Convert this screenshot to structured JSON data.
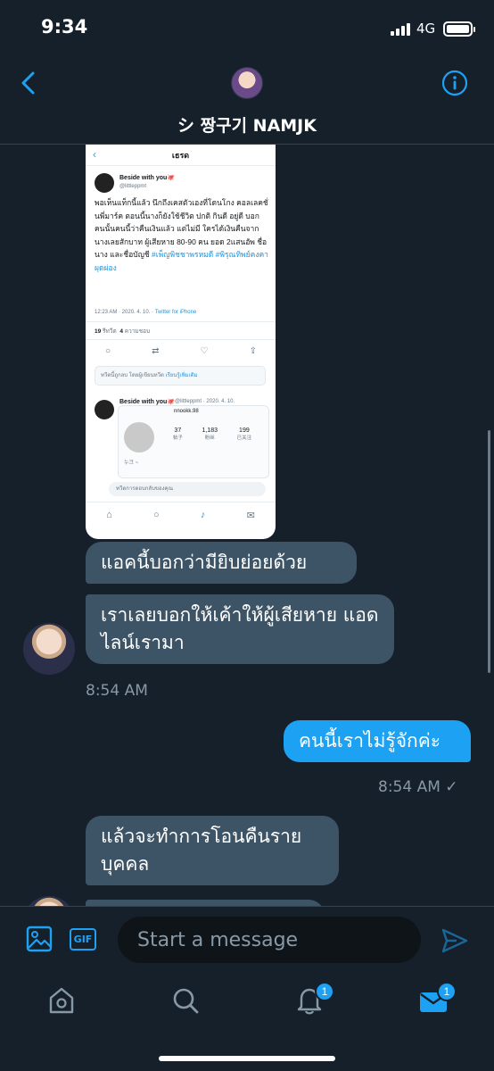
{
  "status_bar": {
    "time": "9:34",
    "network": "4G"
  },
  "header": {
    "contact_name": "シ 짱구기 NAMJK"
  },
  "attachment": {
    "title": "เธรด",
    "author_name": "Beside with you🐙",
    "author_handle": "@littleppmt",
    "body": "พอเห็นแท็กนี้แล้ว นึกถึงเคสตัวเองที่โดนโกง คอลเลคชั่นพี่มาร์ค ตอนนี้นางก็ยังใช้ชีวิต ปกติ กินดี อยู่ดี บอกคนนั้นคนนี้ว่าคืนเงินแล้ว แต่ไม่มี ใครได้เงินคืนจากนางเลยสักบาท ผู้เสียหาย 80-90 คน ยอด 2แสนอัพ ชื่อนาง และชื่อบัญชี",
    "hashtags": "#เพ็ญพิชชาพรหมดี #พิรุณทิพย์คงคาผุดผ่อง",
    "timestamp": "12:23 AM · 2020. 4. 10.",
    "source": "Twitter for iPhone",
    "retweets": "19",
    "retweets_label": "รีทวีต",
    "likes": "4",
    "likes_label": "ความชอบ",
    "notice": "ทวีตนี้ถูกลบ โดยผู้เขียนทวีต",
    "notice_link": "เรียนรู้เพิ่มเติม",
    "quoted_author": "Beside with you🐙",
    "quoted_meta": "@littleppmt · 2020. 4. 10.",
    "quoted_profile": "nnookk.98",
    "quoted_stats": [
      {
        "value": "37",
        "label": "帖子"
      },
      {
        "value": "1,183",
        "label": "粉丝"
      },
      {
        "value": "199",
        "label": "已关注"
      }
    ],
    "quoted_caption": "누크 ~",
    "reply_placeholder": "ทวีตการตอบกลับของคุณ"
  },
  "messages": [
    {
      "id": "m1",
      "direction": "in",
      "text": "แอคนี้บอกว่ามียิบย่อยด้วย"
    },
    {
      "id": "m2",
      "direction": "in",
      "text": "เราเลยบอกให้เค้าให้ผู้เสียหาย แอดไลน์เรามา",
      "time": "8:54 AM"
    },
    {
      "id": "m3",
      "direction": "out",
      "text": "คนนี้เราไม่รู้จักค่ะ",
      "time": "8:54 AM",
      "status": "✓"
    },
    {
      "id": "m4",
      "direction": "in",
      "text": "แล้วจะทำการโอนคืนราย บุคคล"
    }
  ],
  "composer": {
    "gif_label": "GIF",
    "placeholder": "Start a message"
  },
  "tabs": {
    "notifications_badge": "1",
    "messages_badge": "1"
  },
  "colors": {
    "background": "#15202b",
    "accent": "#1da1f2",
    "incoming_bubble": "#3d5466",
    "muted_text": "#8899a6"
  },
  "icons": [
    "back-chevron-icon",
    "info-icon",
    "image-icon",
    "gif-icon",
    "send-icon",
    "home-icon",
    "search-icon",
    "bell-icon",
    "mail-icon"
  ]
}
